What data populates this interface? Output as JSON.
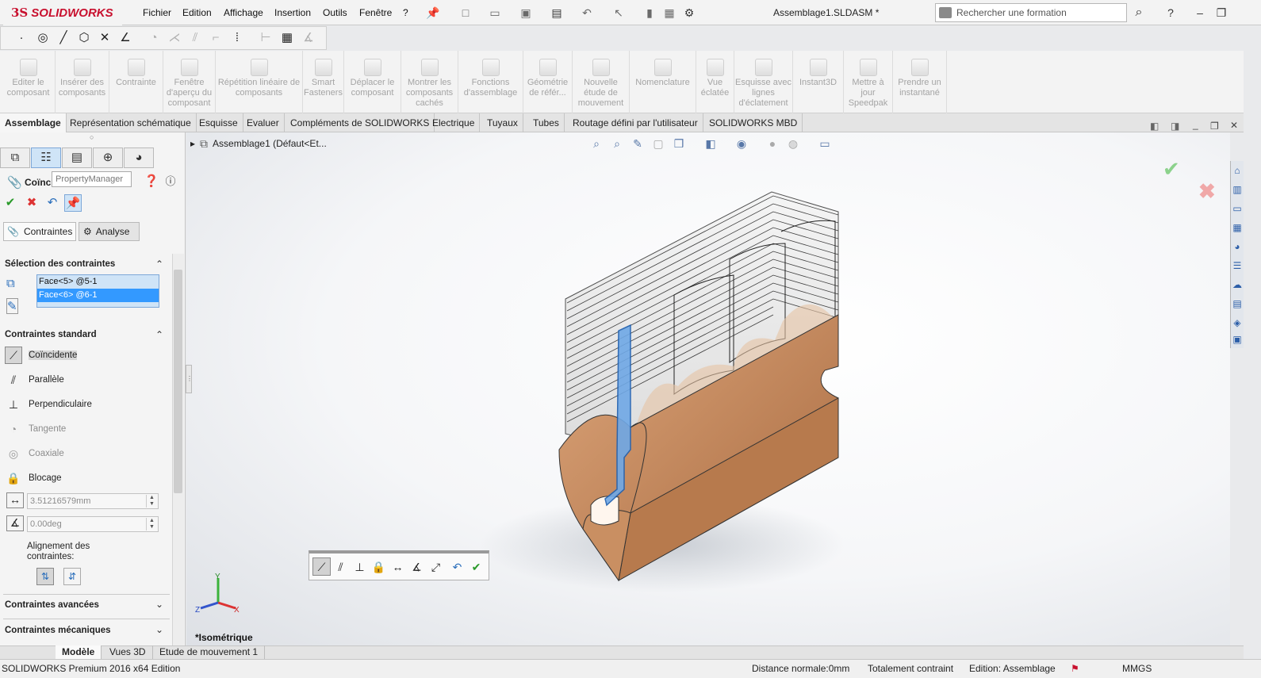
{
  "app": {
    "brand_ds": "3S",
    "brand_name": "SOLIDWORKS",
    "document_title": "Assemblage1.SLDASM *"
  },
  "menu": [
    "Fichier",
    "Edition",
    "Affichage",
    "Insertion",
    "Outils",
    "Fenêtre",
    "?"
  ],
  "search": {
    "placeholder": "Rechercher une formation"
  },
  "command_manager": [
    {
      "label": "Editer le composant"
    },
    {
      "label": "Insérer des composants"
    },
    {
      "label": "Contrainte"
    },
    {
      "label": "Fenêtre d'aperçu du composant"
    },
    {
      "label": "Répétition linéaire de composants"
    },
    {
      "label": "Smart Fasteners"
    },
    {
      "label": "Déplacer le composant"
    },
    {
      "label": "Montrer les composants cachés"
    },
    {
      "label": "Fonctions d'assemblage"
    },
    {
      "label": "Géométrie de référ..."
    },
    {
      "label": "Nouvelle étude de mouvement"
    },
    {
      "label": "Nomenclature"
    },
    {
      "label": "Vue éclatée"
    },
    {
      "label": "Esquisse avec lignes d'éclatement"
    },
    {
      "label": "Instant3D"
    },
    {
      "label": "Mettre à jour Speedpak"
    },
    {
      "label": "Prendre un instantané"
    }
  ],
  "tabs": [
    "Assemblage",
    "Représentation schématique",
    "Esquisse",
    "Evaluer",
    "Compléments de SOLIDWORKS",
    "Electrique",
    "Tuyaux",
    "Tubes",
    "Routage défini par l'utilisateur",
    "SOLIDWORKS MBD"
  ],
  "property_manager": {
    "tooltip": "PropertyManager",
    "title": "Coïncidente3",
    "subtabs": [
      "Contraintes",
      "Analyse"
    ],
    "selection_header": "Sélection des contraintes",
    "selections": [
      "Face<5> @5-1",
      "Face<6> @6-1"
    ],
    "standard_header": "Contraintes standard",
    "standard_mates": [
      "Coïncidente",
      "Parallèle",
      "Perpendiculaire",
      "Tangente",
      "Coaxiale",
      "Blocage"
    ],
    "distance_value": "3.51216579mm",
    "angle_value": "0.00deg",
    "alignment_label": "Alignement des contraintes:",
    "advanced_header": "Contraintes avancées",
    "mechanical_header": "Contraintes mécaniques"
  },
  "viewport": {
    "breadcrumb": "Assemblage1  (Défaut<Et...",
    "view_label": "*Isométrique",
    "axis_x": "X",
    "axis_y": "Y",
    "axis_z": "Z"
  },
  "bottom_tabs": [
    "Modèle",
    "Vues 3D",
    "Etude de mouvement 1"
  ],
  "status": {
    "product": "SOLIDWORKS Premium 2016 x64 Edition",
    "distance": "Distance normale:0mm",
    "constraint": "Totalement contraint",
    "mode": "Edition: Assemblage",
    "units": "MMGS"
  },
  "colors": {
    "accent_red": "#c8102e",
    "selection_blue": "#3399ff",
    "part_fill": "#c58a5e"
  }
}
